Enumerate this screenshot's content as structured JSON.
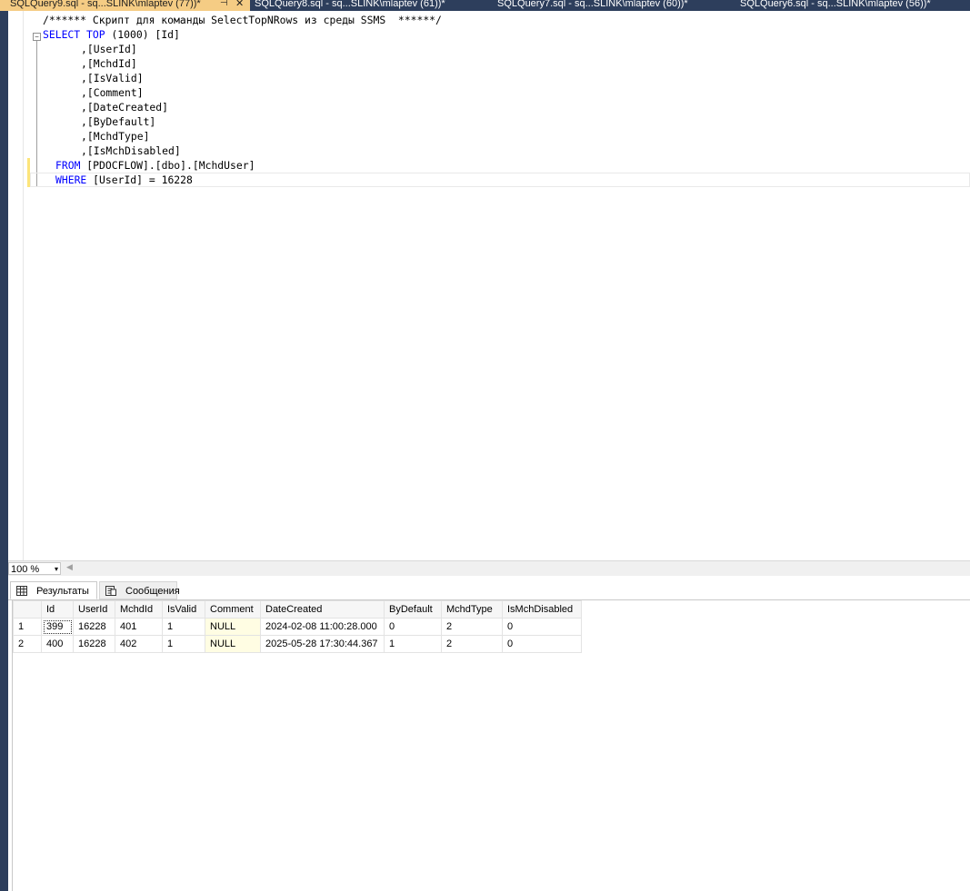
{
  "tabs": [
    {
      "label": "SQLQuery9.sql - sq...SLINK\\mlaptev (77))*",
      "pin": "⊣",
      "close": "✕"
    },
    {
      "label": "SQLQuery8.sql - sq...SLINK\\mlaptev (61))*"
    },
    {
      "label": "SQLQuery7.sql - sq...SLINK\\mlaptev (60))*"
    },
    {
      "label": "SQLQuery6.sql - sq...SLINK\\mlaptev (56))*"
    }
  ],
  "editor": {
    "comment": "/****** Скрипт для команды SelectTopNRows из среды SSMS  ******/",
    "select": "SELECT",
    "top": "TOP",
    "top_value": " (1000) [Id]",
    "columns": [
      ",[UserId]",
      ",[MchdId]",
      ",[IsValid]",
      ",[Comment]",
      ",[DateCreated]",
      ",[ByDefault]",
      ",[MchdType]",
      ",[IsMchDisabled]"
    ],
    "from_kw": "FROM",
    "from_obj": " [PDOCFLOW].[dbo].[MchdUser]",
    "where_kw": "WHERE",
    "where_expr": " [UserId] = 16228",
    "collapse_glyph": "−"
  },
  "status": {
    "zoom": "100 %",
    "zoom_arrow": "▾",
    "scroll_left": "◀"
  },
  "results": {
    "tab_results": "Результаты",
    "tab_messages": "Сообщения",
    "headers": [
      "Id",
      "UserId",
      "MchdId",
      "IsValid",
      "Comment",
      "DateCreated",
      "ByDefault",
      "MchdType",
      "IsMchDisabled"
    ],
    "rows": [
      {
        "rn": "1",
        "cells": [
          "399",
          "16228",
          "401",
          "1",
          "NULL",
          "2024-02-08 11:00:28.000",
          "0",
          "2",
          "0"
        ]
      },
      {
        "rn": "2",
        "cells": [
          "400",
          "16228",
          "402",
          "1",
          "NULL",
          "2025-05-28 17:30:44.367",
          "1",
          "2",
          "0"
        ]
      }
    ]
  },
  "colors": {
    "tabbar": "#2d3e5c",
    "active_tab": "#f5cc84",
    "keyword": "#0000ff",
    "comment": "#008000",
    "null_cell": "#fffde3"
  }
}
